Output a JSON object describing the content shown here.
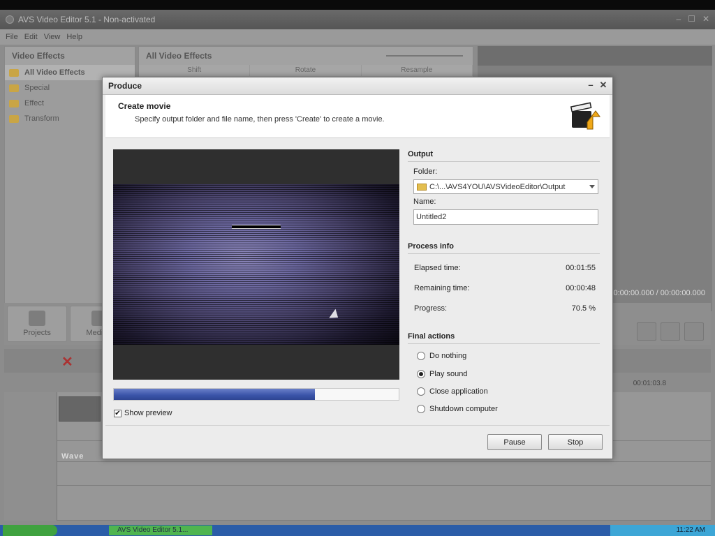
{
  "app": {
    "title": "AVS Video Editor 5.1 - Non-activated",
    "menu": [
      "File",
      "Edit",
      "View",
      "Help"
    ]
  },
  "left_panel": {
    "header": "Video Effects",
    "items": [
      "All Video Effects",
      "Special",
      "Effect",
      "Transform"
    ]
  },
  "mid_panel": {
    "header": "All Video Effects",
    "columns": [
      "Shift",
      "Rotate",
      "Resample"
    ]
  },
  "player": {
    "time": "00:00:00.000 / 00:00:00.000"
  },
  "toolbar": {
    "projects_label": "Projects",
    "media_label": "Media L"
  },
  "timeline": {
    "time_marker": "00:01:03.8",
    "wave_label": "Wave"
  },
  "taskbar": {
    "task_label": "AVS Video Editor 5.1...",
    "clock": "11:22 AM"
  },
  "dialog": {
    "title": "Produce",
    "header_title": "Create movie",
    "header_desc": "Specify output folder and file name, then press 'Create' to create a movie.",
    "output": {
      "section": "Output",
      "folder_label": "Folder:",
      "folder_value": "C:\\...\\AVS4YOU\\AVSVideoEditor\\Output",
      "name_label": "Name:",
      "name_value": "Untitled2"
    },
    "process": {
      "section": "Process info",
      "elapsed_label": "Elapsed time:",
      "elapsed_value": "00:01:55",
      "remaining_label": "Remaining time:",
      "remaining_value": "00:00:48",
      "progress_label": "Progress:",
      "progress_value": "70.5 %",
      "progress_fraction": 0.705
    },
    "final_actions": {
      "section": "Final actions",
      "options": [
        "Do nothing",
        "Play sound",
        "Close application",
        "Shutdown computer"
      ],
      "selected": "Play sound"
    },
    "show_preview_label": "Show preview",
    "show_preview_checked": true,
    "pause_label": "Pause",
    "stop_label": "Stop"
  }
}
